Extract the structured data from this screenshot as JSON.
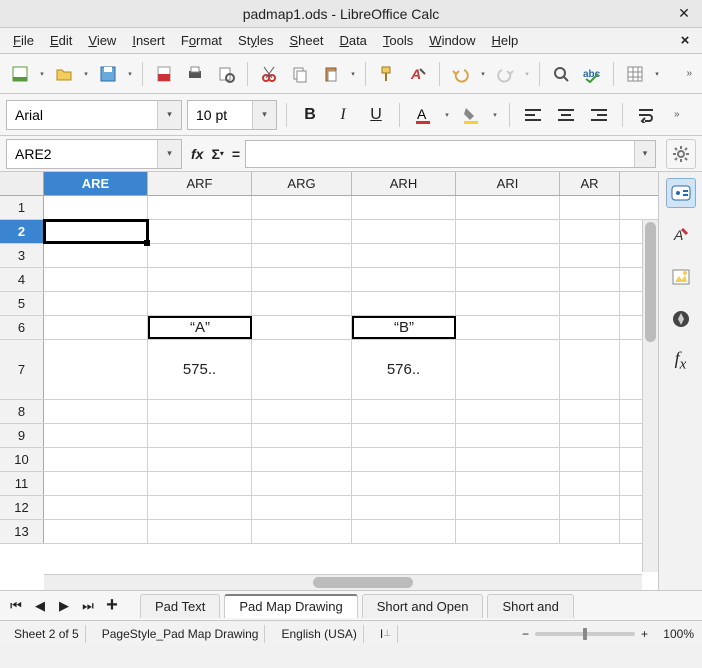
{
  "window": {
    "title": "padmap1.ods - LibreOffice Calc"
  },
  "menus": {
    "file": "File",
    "edit": "Edit",
    "view": "View",
    "insert": "Insert",
    "format": "Format",
    "styles": "Styles",
    "sheet": "Sheet",
    "data": "Data",
    "tools": "Tools",
    "window": "Window",
    "help": "Help"
  },
  "format_bar": {
    "font_name": "Arial",
    "font_size": "10 pt"
  },
  "formula_bar": {
    "name_box": "ARE2",
    "fx_label": "fx",
    "sigma_label": "Σ",
    "eq_label": "=",
    "formula": ""
  },
  "columns": {
    "are": "ARE",
    "arf": "ARF",
    "arg": "ARG",
    "arh": "ARH",
    "ari": "ARI",
    "arj": "AR"
  },
  "rows": [
    "1",
    "2",
    "3",
    "4",
    "5",
    "6",
    "7",
    "8",
    "9",
    "10",
    "11",
    "12",
    "13"
  ],
  "cells": {
    "arf6": "“A”",
    "arh6": "“B”",
    "arf7": "575..",
    "arh7": "576.."
  },
  "tabs": {
    "t1": "Pad Text",
    "t2": "Pad Map Drawing",
    "t3": "Short and Open",
    "t4": "Short and"
  },
  "status": {
    "sheet": "Sheet 2 of 5",
    "style": "PageStyle_Pad Map Drawing",
    "lang": "English (USA)",
    "insert": "I",
    "zoom": "100%"
  },
  "chart_data": {
    "type": "table",
    "note": "Spreadsheet cells visible in viewport",
    "columns": [
      "ARE",
      "ARF",
      "ARG",
      "ARH",
      "ARI"
    ],
    "rows": [
      {
        "r": 6,
        "ARF": "\"A\"",
        "ARH": "\"B\""
      },
      {
        "r": 7,
        "ARF": "575..",
        "ARH": "576.."
      }
    ],
    "selected_cell": "ARE2"
  }
}
